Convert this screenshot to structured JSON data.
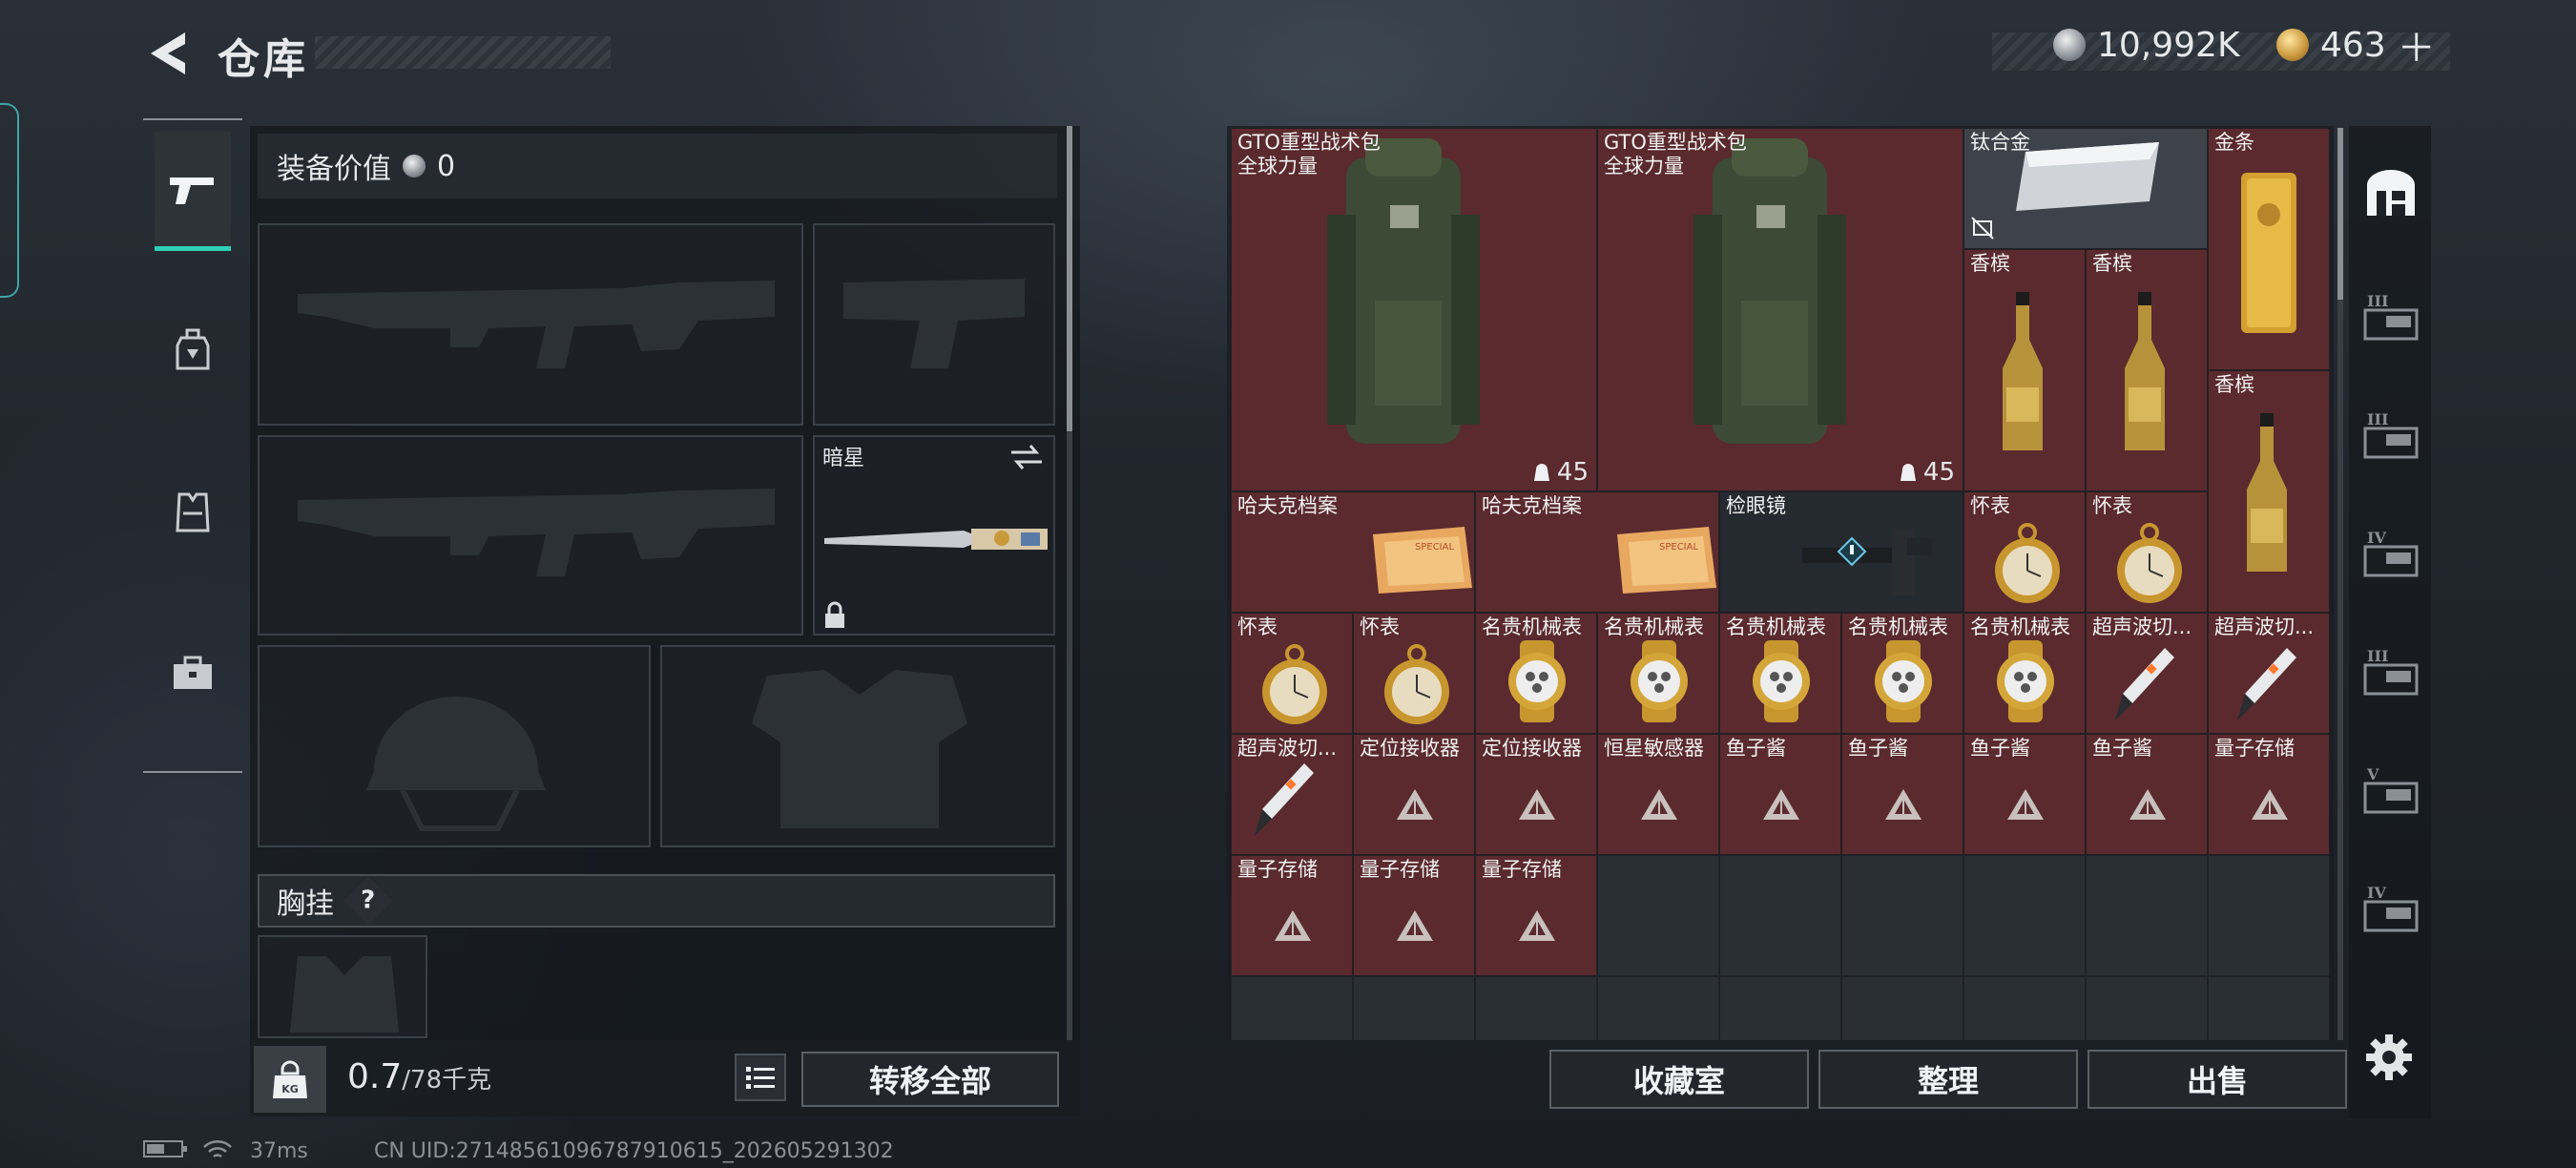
{
  "header": {
    "title": "仓库",
    "silver": "10,992K",
    "gold": "463",
    "gold_plus": "＋"
  },
  "loadout": {
    "equip_value_label": "装备价值",
    "equip_value": "0",
    "melee_name": "暗星",
    "chest_label": "胸挂",
    "weight": "0.7",
    "weight_max": "/78千克",
    "kg_icon_text": "KG",
    "transfer_all": "转移全部"
  },
  "storage": {
    "items": [
      {
        "name": "GTO重型战术包\n全球力量",
        "count": "45",
        "icon": "backpack-icon"
      },
      {
        "name": "GTO重型战术包\n全球力量",
        "count": "45",
        "icon": "backpack-icon"
      },
      {
        "name": "钛合金",
        "icon": "titanium-ingot-icon"
      },
      {
        "name": "金条",
        "icon": "gold-bar-icon"
      },
      {
        "name": "香槟",
        "icon": "champagne-icon"
      },
      {
        "name": "香槟",
        "icon": "champagne-icon"
      },
      {
        "name": "香槟",
        "icon": "champagne-icon"
      },
      {
        "name": "哈夫克档案",
        "icon": "file-icon"
      },
      {
        "name": "哈夫克档案",
        "icon": "file-icon"
      },
      {
        "name": "检眼镜",
        "icon": "ophthalmoscope-icon"
      },
      {
        "name": "怀表",
        "icon": "pocket-watch-icon"
      },
      {
        "name": "怀表",
        "icon": "pocket-watch-icon"
      },
      {
        "name": "怀表",
        "icon": "pocket-watch-icon"
      },
      {
        "name": "怀表",
        "icon": "pocket-watch-icon"
      },
      {
        "name": "名贵机械表",
        "icon": "wristwatch-icon"
      },
      {
        "name": "名贵机械表",
        "icon": "wristwatch-icon"
      },
      {
        "name": "名贵机械表",
        "icon": "wristwatch-icon"
      },
      {
        "name": "名贵机械表",
        "icon": "wristwatch-icon"
      },
      {
        "name": "名贵机械表",
        "icon": "wristwatch-icon"
      },
      {
        "name": "超声波切...",
        "icon": "ultrasonic-cutter-icon"
      },
      {
        "name": "超声波切...",
        "icon": "ultrasonic-cutter-icon"
      },
      {
        "name": "超声波切...",
        "icon": "ultrasonic-cutter-icon"
      },
      {
        "name": "定位接收器",
        "icon": "unknown-item-icon"
      },
      {
        "name": "定位接收器",
        "icon": "unknown-item-icon"
      },
      {
        "name": "恒星敏感器",
        "icon": "unknown-item-icon"
      },
      {
        "name": "鱼子酱",
        "icon": "unknown-item-icon"
      },
      {
        "name": "鱼子酱",
        "icon": "unknown-item-icon"
      },
      {
        "name": "鱼子酱",
        "icon": "unknown-item-icon"
      },
      {
        "name": "鱼子酱",
        "icon": "unknown-item-icon"
      },
      {
        "name": "量子存储",
        "icon": "unknown-item-icon"
      },
      {
        "name": "量子存储",
        "icon": "unknown-item-icon"
      },
      {
        "name": "量子存储",
        "icon": "unknown-item-icon"
      },
      {
        "name": "量子存储",
        "icon": "unknown-item-icon"
      }
    ],
    "buttons": {
      "collection": "收藏室",
      "sort": "整理",
      "sell": "出售"
    }
  },
  "right_sidebar": {
    "tiers": [
      "III",
      "III",
      "IV",
      "III",
      "V",
      "IV"
    ]
  },
  "status_bar": {
    "ping": "37ms",
    "uid": "CN UID:27148561096787910615_202605291302"
  },
  "colors": {
    "accent": "#2fd0b5",
    "item_bg": "#5a2a2e",
    "edge_tab": "#3fa5a8"
  }
}
